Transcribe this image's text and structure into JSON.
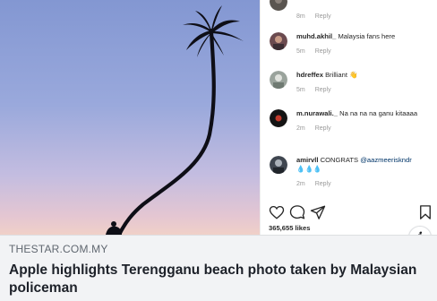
{
  "link_preview": {
    "domain": "THESTAR.COM.MY",
    "headline": "Apple highlights Terengganu beach photo taken by Malaysian policeman"
  },
  "instagram": {
    "comments": [
      {
        "user": "",
        "text": "",
        "time": "8m",
        "reply": "Reply"
      },
      {
        "user": "muhd.akhil_",
        "text": "Malaysia fans here",
        "time": "5m",
        "reply": "Reply"
      },
      {
        "user": "hdreffex",
        "text": "Brilliant 👋",
        "time": "5m",
        "reply": "Reply"
      },
      {
        "user": "m.nurawali._",
        "text": "Na na na na ganu kitaaaa",
        "time": "2m",
        "reply": "Reply"
      },
      {
        "user": "amirvll",
        "text": "CONGRATS",
        "mention": "@aazmeeriskndr",
        "extra": "💧💧💧",
        "time": "2m",
        "reply": "Reply"
      }
    ],
    "likes": "365,655 likes",
    "action_icons": [
      "heart-icon",
      "comment-icon",
      "share-icon",
      "bookmark-icon"
    ]
  },
  "info_button": {
    "label": "i"
  },
  "colors": {
    "caption_bg": "#f2f3f5",
    "domain_text": "#606770",
    "headline_text": "#1d2129",
    "sky_top": "#8a9ed6",
    "sky_horizon": "#e8c7c9"
  }
}
